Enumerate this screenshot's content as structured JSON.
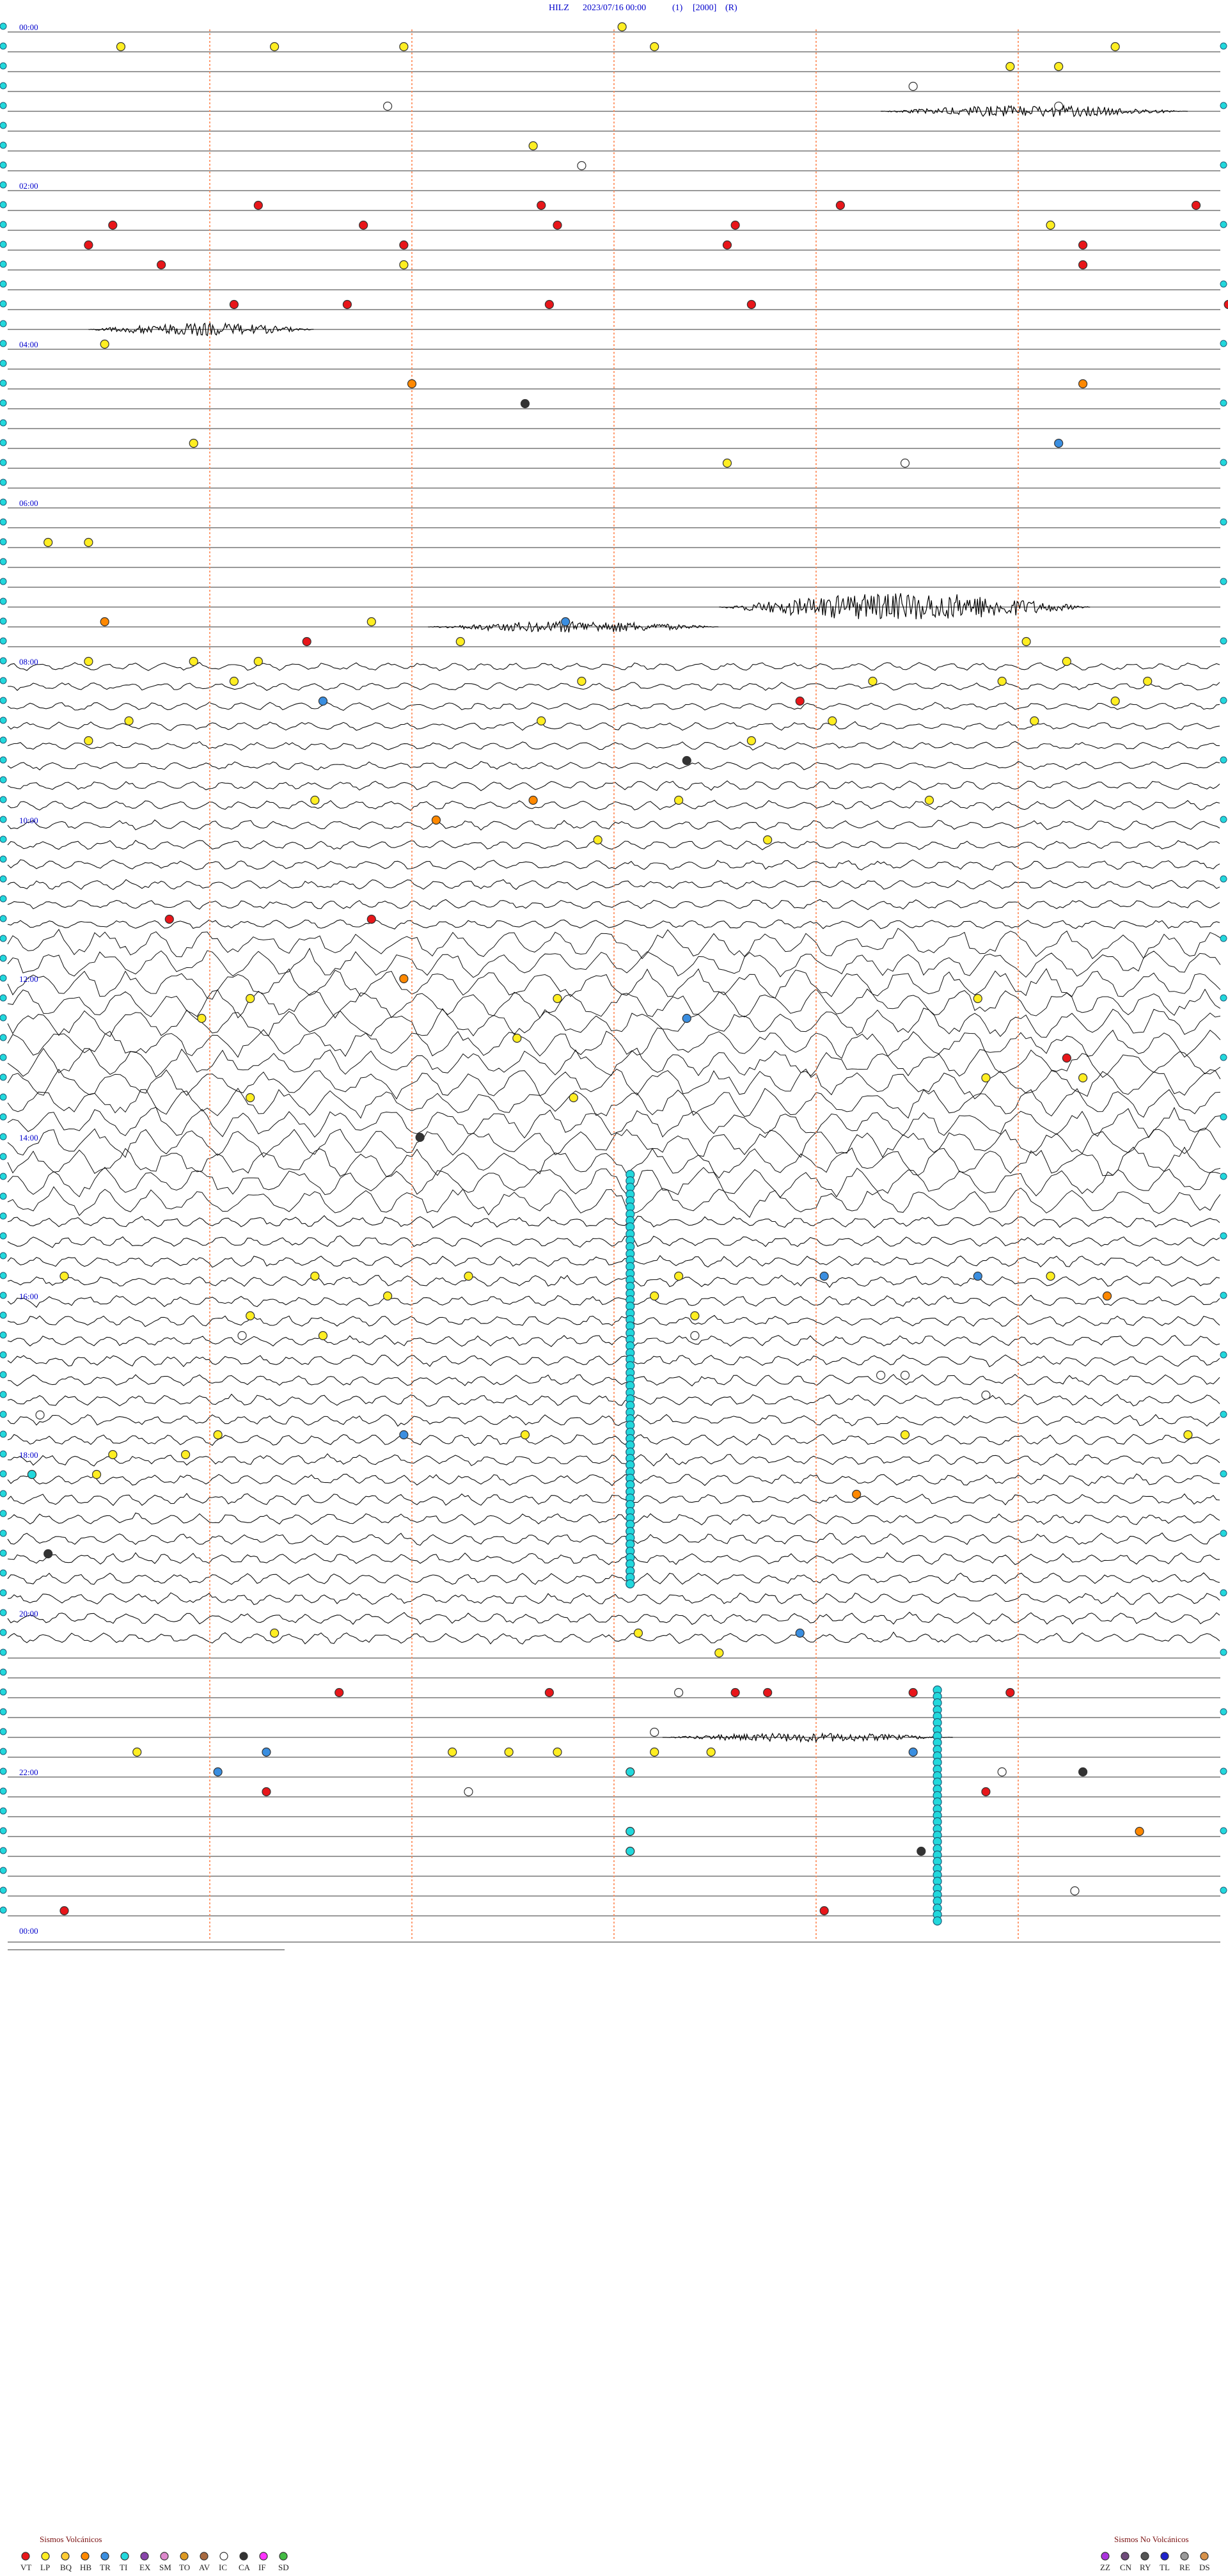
{
  "header": {
    "station": "HILZ",
    "datetime": "2023/07/16 00:00",
    "flag1": "(1)",
    "scale": "[2000]",
    "flag2": "(R)"
  },
  "chart_data": {
    "type": "seismogram",
    "rows_total": 96,
    "minutes_per_row": 15,
    "hour_labels": [
      "00:00",
      "02:00",
      "04:00",
      "06:00",
      "08:00",
      "10:00",
      "12:00",
      "14:00",
      "16:00",
      "18:00",
      "20:00",
      "22:00",
      "00:00"
    ],
    "label_every_rows": 8,
    "minute_markers": [
      2.5,
      5,
      7.5,
      10,
      12.5
    ],
    "noise_level_by_row": [
      0,
      0,
      0,
      0,
      0,
      0,
      0,
      0,
      0,
      0,
      0,
      0,
      0,
      0,
      0,
      0,
      0,
      0,
      0,
      0,
      0,
      0,
      0,
      0,
      0,
      0,
      0,
      0,
      0,
      0,
      0,
      0,
      5,
      5,
      5,
      5,
      5,
      5,
      6,
      6,
      6,
      6,
      6,
      6,
      6,
      6,
      18,
      18,
      18,
      18,
      18,
      18,
      18,
      18,
      18,
      18,
      18,
      18,
      18,
      18,
      7,
      7,
      7,
      7,
      7,
      7,
      7,
      7,
      7,
      7,
      7,
      7,
      7,
      7,
      7,
      7,
      7,
      7,
      7,
      7,
      7,
      7,
      0,
      0,
      0,
      0,
      0,
      0,
      0,
      0,
      0,
      0,
      0,
      0,
      0,
      0,
      0,
      0
    ],
    "events": [
      {
        "row": 0,
        "min": 7.6,
        "type": "LP"
      },
      {
        "row": 0,
        "min": 15.6,
        "type": "LP"
      },
      {
        "row": 0,
        "min": 16.1,
        "type": "LP"
      },
      {
        "row": 0,
        "min": 17.2,
        "type": "TR"
      },
      {
        "row": 1,
        "min": 1.4,
        "type": "LP"
      },
      {
        "row": 1,
        "min": 3.3,
        "type": "LP"
      },
      {
        "row": 1,
        "min": 4.9,
        "type": "LP"
      },
      {
        "row": 1,
        "min": 8.0,
        "type": "LP"
      },
      {
        "row": 1,
        "min": 13.7,
        "type": "LP"
      },
      {
        "row": 1,
        "min": 15.6,
        "type": "LP"
      },
      {
        "row": 1,
        "min": 16.5,
        "type": "LP"
      },
      {
        "row": 2,
        "min": 12.4,
        "type": "LP"
      },
      {
        "row": 2,
        "min": 13.0,
        "type": "LP"
      },
      {
        "row": 3,
        "min": 11.2,
        "type": "IC"
      },
      {
        "row": 4,
        "min": 4.7,
        "type": "IC"
      },
      {
        "row": 4,
        "min": 13.0,
        "type": "IC"
      },
      {
        "row": 6,
        "min": 6.5,
        "type": "LP"
      },
      {
        "row": 7,
        "min": 7.1,
        "type": "IC"
      },
      {
        "row": 9,
        "min": 3.1,
        "type": "VT"
      },
      {
        "row": 9,
        "min": 6.6,
        "type": "VT"
      },
      {
        "row": 9,
        "min": 10.3,
        "type": "VT"
      },
      {
        "row": 9,
        "min": 14.7,
        "type": "VT"
      },
      {
        "row": 10,
        "min": 1.3,
        "type": "VT"
      },
      {
        "row": 10,
        "min": 4.4,
        "type": "VT"
      },
      {
        "row": 10,
        "min": 6.8,
        "type": "VT"
      },
      {
        "row": 10,
        "min": 9.0,
        "type": "VT"
      },
      {
        "row": 10,
        "min": 12.9,
        "type": "LP"
      },
      {
        "row": 10,
        "min": 16.9,
        "type": "VT"
      },
      {
        "row": 10,
        "min": 19.0,
        "type": "VT"
      },
      {
        "row": 11,
        "min": 1.0,
        "type": "VT"
      },
      {
        "row": 11,
        "min": 4.9,
        "type": "VT"
      },
      {
        "row": 11,
        "min": 8.9,
        "type": "VT"
      },
      {
        "row": 11,
        "min": 13.3,
        "type": "VT"
      },
      {
        "row": 11,
        "min": 16.1,
        "type": "VT"
      },
      {
        "row": 11,
        "min": 16.8,
        "type": "VT"
      },
      {
        "row": 12,
        "min": 1.9,
        "type": "VT"
      },
      {
        "row": 12,
        "min": 4.9,
        "type": "LP"
      },
      {
        "row": 12,
        "min": 13.3,
        "type": "VT"
      },
      {
        "row": 12,
        "min": 16.1,
        "type": "LP"
      },
      {
        "row": 12,
        "min": 19.0,
        "type": "LP"
      },
      {
        "row": 13,
        "min": 15.8,
        "type": "IC"
      },
      {
        "row": 14,
        "min": 2.8,
        "type": "VT"
      },
      {
        "row": 14,
        "min": 4.2,
        "type": "VT"
      },
      {
        "row": 14,
        "min": 6.7,
        "type": "VT"
      },
      {
        "row": 14,
        "min": 9.2,
        "type": "VT"
      },
      {
        "row": 14,
        "min": 15.1,
        "type": "VT"
      },
      {
        "row": 14,
        "min": 18.2,
        "type": "VT"
      },
      {
        "row": 14,
        "min": 19.0,
        "type": "VT"
      },
      {
        "row": 15,
        "min": 18.2,
        "type": "LP"
      },
      {
        "row": 16,
        "min": 1.2,
        "type": "LP"
      },
      {
        "row": 18,
        "min": 5.0,
        "type": "HB"
      },
      {
        "row": 18,
        "min": 13.3,
        "type": "HB"
      },
      {
        "row": 19,
        "min": 6.4,
        "type": "CA"
      },
      {
        "row": 21,
        "min": 2.3,
        "type": "LP"
      },
      {
        "row": 21,
        "min": 13.0,
        "type": "TR"
      },
      {
        "row": 21,
        "min": 17.7,
        "type": "LP"
      },
      {
        "row": 22,
        "min": 8.9,
        "type": "LP"
      },
      {
        "row": 22,
        "min": 11.1,
        "type": "IC"
      },
      {
        "row": 26,
        "min": 0.5,
        "type": "LP"
      },
      {
        "row": 26,
        "min": 1.0,
        "type": "LP"
      },
      {
        "row": 30,
        "min": 4.5,
        "type": "LP"
      },
      {
        "row": 30,
        "min": 6.9,
        "type": "TR"
      },
      {
        "row": 30,
        "min": 1.2,
        "type": "HB"
      },
      {
        "row": 31,
        "min": 5.6,
        "type": "LP"
      },
      {
        "row": 31,
        "min": 3.7,
        "type": "VT"
      },
      {
        "row": 31,
        "min": 12.6,
        "type": "LP"
      },
      {
        "row": 32,
        "min": 1.0,
        "type": "LP"
      },
      {
        "row": 32,
        "min": 2.3,
        "type": "LP"
      },
      {
        "row": 32,
        "min": 3.1,
        "type": "LP"
      },
      {
        "row": 32,
        "min": 13.1,
        "type": "LP"
      },
      {
        "row": 33,
        "min": 15.4,
        "type": "TI"
      },
      {
        "row": 33,
        "min": 2.8,
        "type": "LP"
      },
      {
        "row": 33,
        "min": 7.1,
        "type": "LP"
      },
      {
        "row": 33,
        "min": 10.7,
        "type": "LP"
      },
      {
        "row": 33,
        "min": 12.3,
        "type": "LP"
      },
      {
        "row": 33,
        "min": 14.1,
        "type": "LP"
      },
      {
        "row": 33,
        "min": 15.6,
        "type": "VT"
      },
      {
        "row": 33,
        "min": 16.7,
        "type": "LP"
      },
      {
        "row": 33,
        "min": 17.8,
        "type": "LP"
      },
      {
        "row": 34,
        "min": 3.9,
        "type": "TR"
      },
      {
        "row": 34,
        "min": 9.8,
        "type": "VT"
      },
      {
        "row": 34,
        "min": 13.7,
        "type": "LP"
      },
      {
        "row": 34,
        "min": 18.6,
        "type": "LP"
      },
      {
        "row": 35,
        "min": 1.5,
        "type": "LP"
      },
      {
        "row": 35,
        "min": 6.6,
        "type": "LP"
      },
      {
        "row": 35,
        "min": 10.2,
        "type": "LP"
      },
      {
        "row": 35,
        "min": 12.7,
        "type": "LP"
      },
      {
        "row": 35,
        "min": 15.4,
        "type": "TI"
      },
      {
        "row": 36,
        "min": 15.6,
        "type": "VT"
      },
      {
        "row": 36,
        "min": 16.3,
        "type": "LP"
      },
      {
        "row": 36,
        "min": 9.2,
        "type": "LP"
      },
      {
        "row": 36,
        "min": 1.0,
        "type": "LP"
      },
      {
        "row": 37,
        "min": 8.4,
        "type": "CA"
      },
      {
        "row": 39,
        "min": 3.8,
        "type": "LP"
      },
      {
        "row": 39,
        "min": 6.5,
        "type": "HB"
      },
      {
        "row": 39,
        "min": 8.3,
        "type": "LP"
      },
      {
        "row": 39,
        "min": 11.4,
        "type": "LP"
      },
      {
        "row": 40,
        "min": 5.3,
        "type": "HB"
      },
      {
        "row": 40,
        "min": 17.8,
        "type": "VT"
      },
      {
        "row": 41,
        "min": 7.3,
        "type": "LP"
      },
      {
        "row": 41,
        "min": 9.4,
        "type": "LP"
      },
      {
        "row": 45,
        "min": 4.5,
        "type": "VT"
      },
      {
        "row": 45,
        "min": 2.0,
        "type": "VT"
      },
      {
        "row": 45,
        "min": 17.7,
        "type": "LP"
      },
      {
        "row": 48,
        "min": 4.9,
        "type": "HB"
      },
      {
        "row": 48,
        "min": 18.4,
        "type": "VT"
      },
      {
        "row": 49,
        "min": 3.0,
        "type": "LP"
      },
      {
        "row": 49,
        "min": 12.0,
        "type": "LP"
      },
      {
        "row": 49,
        "min": 6.8,
        "type": "LP"
      },
      {
        "row": 49,
        "min": 15.3,
        "type": "TI"
      },
      {
        "row": 50,
        "min": 2.4,
        "type": "LP"
      },
      {
        "row": 50,
        "min": 8.4,
        "type": "TR"
      },
      {
        "row": 50,
        "min": 15.8,
        "type": "TR"
      },
      {
        "row": 51,
        "min": 6.3,
        "type": "LP"
      },
      {
        "row": 52,
        "min": 13.1,
        "type": "VT"
      },
      {
        "row": 53,
        "min": 12.1,
        "type": "LP"
      },
      {
        "row": 53,
        "min": 13.3,
        "type": "LP"
      },
      {
        "row": 54,
        "min": 3.0,
        "type": "LP"
      },
      {
        "row": 54,
        "min": 7.0,
        "type": "LP"
      },
      {
        "row": 56,
        "min": 5.1,
        "type": "CA"
      },
      {
        "row": 58,
        "min": 18.8,
        "type": "VT"
      },
      {
        "row": 63,
        "min": 0.7,
        "type": "LP"
      },
      {
        "row": 63,
        "min": 3.8,
        "type": "LP"
      },
      {
        "row": 63,
        "min": 5.7,
        "type": "LP"
      },
      {
        "row": 63,
        "min": 8.3,
        "type": "LP"
      },
      {
        "row": 63,
        "min": 10.1,
        "type": "TR"
      },
      {
        "row": 63,
        "min": 12.0,
        "type": "TR"
      },
      {
        "row": 63,
        "min": 12.9,
        "type": "LP"
      },
      {
        "row": 64,
        "min": 4.7,
        "type": "LP"
      },
      {
        "row": 64,
        "min": 8.0,
        "type": "LP"
      },
      {
        "row": 64,
        "min": 13.6,
        "type": "HB"
      },
      {
        "row": 64,
        "min": 17.9,
        "type": "LP"
      },
      {
        "row": 65,
        "min": 3.0,
        "type": "LP"
      },
      {
        "row": 65,
        "min": 8.5,
        "type": "LP"
      },
      {
        "row": 66,
        "min": 2.9,
        "type": "IC"
      },
      {
        "row": 66,
        "min": 3.9,
        "type": "LP"
      },
      {
        "row": 66,
        "min": 8.5,
        "type": "IC"
      },
      {
        "row": 67,
        "min": 18.2,
        "type": "VT"
      },
      {
        "row": 68,
        "min": 10.8,
        "type": "IC"
      },
      {
        "row": 68,
        "min": 11.1,
        "type": "IC"
      },
      {
        "row": 69,
        "min": 12.1,
        "type": "IC"
      },
      {
        "row": 70,
        "min": 0.4,
        "type": "IC"
      },
      {
        "row": 71,
        "min": 2.6,
        "type": "LP"
      },
      {
        "row": 71,
        "min": 4.9,
        "type": "TR"
      },
      {
        "row": 71,
        "min": 6.4,
        "type": "LP"
      },
      {
        "row": 71,
        "min": 11.1,
        "type": "LP"
      },
      {
        "row": 71,
        "min": 14.6,
        "type": "LP"
      },
      {
        "row": 71,
        "min": 15.3,
        "type": "TI"
      },
      {
        "row": 72,
        "min": 1.3,
        "type": "LP"
      },
      {
        "row": 72,
        "min": 2.2,
        "type": "LP"
      },
      {
        "row": 73,
        "min": 1.1,
        "type": "LP"
      },
      {
        "row": 73,
        "min": 0.3,
        "type": "TI"
      },
      {
        "row": 74,
        "min": 10.5,
        "type": "HB"
      },
      {
        "row": 75,
        "min": 16.9,
        "type": "AV"
      },
      {
        "row": 76,
        "min": 15.3,
        "type": "TI"
      },
      {
        "row": 77,
        "min": 0.5,
        "type": "CA"
      },
      {
        "row": 81,
        "min": 3.3,
        "type": "LP"
      },
      {
        "row": 81,
        "min": 7.8,
        "type": "LP"
      },
      {
        "row": 81,
        "min": 9.8,
        "type": "TR"
      },
      {
        "row": 82,
        "min": 8.8,
        "type": "LP"
      },
      {
        "row": 84,
        "min": 4.1,
        "type": "VT"
      },
      {
        "row": 84,
        "min": 6.7,
        "type": "VT"
      },
      {
        "row": 84,
        "min": 8.3,
        "type": "IC"
      },
      {
        "row": 84,
        "min": 9.0,
        "type": "VT"
      },
      {
        "row": 84,
        "min": 9.4,
        "type": "VT"
      },
      {
        "row": 84,
        "min": 11.2,
        "type": "VT"
      },
      {
        "row": 84,
        "min": 12.4,
        "type": "VT"
      },
      {
        "row": 86,
        "min": 8.0,
        "type": "IC"
      },
      {
        "row": 87,
        "min": 1.6,
        "type": "LP"
      },
      {
        "row": 87,
        "min": 3.2,
        "type": "TR"
      },
      {
        "row": 87,
        "min": 5.5,
        "type": "LP"
      },
      {
        "row": 87,
        "min": 6.2,
        "type": "LP"
      },
      {
        "row": 87,
        "min": 6.8,
        "type": "LP"
      },
      {
        "row": 87,
        "min": 8.0,
        "type": "LP"
      },
      {
        "row": 87,
        "min": 8.7,
        "type": "LP"
      },
      {
        "row": 87,
        "min": 11.2,
        "type": "TR"
      },
      {
        "row": 88,
        "min": 2.6,
        "type": "TR"
      },
      {
        "row": 88,
        "min": 7.7,
        "type": "TI"
      },
      {
        "row": 88,
        "min": 12.3,
        "type": "IC"
      },
      {
        "row": 88,
        "min": 13.3,
        "type": "CA"
      },
      {
        "row": 89,
        "min": 3.2,
        "type": "VT"
      },
      {
        "row": 89,
        "min": 5.7,
        "type": "IC"
      },
      {
        "row": 89,
        "min": 12.1,
        "type": "VT"
      },
      {
        "row": 89,
        "min": 16.0,
        "type": "CA"
      },
      {
        "row": 91,
        "min": 14.0,
        "type": "HB"
      },
      {
        "row": 91,
        "min": 7.7,
        "type": "TI"
      },
      {
        "row": 92,
        "min": 7.7,
        "type": "TI"
      },
      {
        "row": 92,
        "min": 11.3,
        "type": "CA"
      },
      {
        "row": 94,
        "min": 18.6,
        "type": "IC"
      },
      {
        "row": 94,
        "min": 13.2,
        "type": "IC"
      },
      {
        "row": 95,
        "min": 10.1,
        "type": "VT"
      },
      {
        "row": 95,
        "min": 0.7,
        "type": "VT"
      }
    ],
    "ti_columns": [
      {
        "min": 7.7,
        "row_from": 71,
        "row_to": 78
      },
      {
        "min": 11.5,
        "row_from": 84,
        "row_to": 95
      },
      {
        "min": 7.7,
        "row_from": 58,
        "row_to": 78
      }
    ],
    "bursts": [
      {
        "row": 4,
        "min_from": 10.8,
        "min_to": 14.6,
        "amp": 9
      },
      {
        "row": 15,
        "min_from": 1.0,
        "min_to": 3.8,
        "amp": 10
      },
      {
        "row": 29,
        "min_from": 8.8,
        "min_to": 13.4,
        "amp": 22
      },
      {
        "row": 30,
        "min_from": 5.2,
        "min_to": 8.8,
        "amp": 9
      },
      {
        "row": 86,
        "min_from": 8.1,
        "min_to": 11.7,
        "amp": 7
      }
    ]
  },
  "legend": {
    "volcanic_title": "Sismos Volcánicos",
    "volcanic": [
      {
        "code": "VT",
        "color": "#e8161a"
      },
      {
        "code": "LP",
        "color": "#ffee22"
      },
      {
        "code": "BQ",
        "color": "#ffcc33"
      },
      {
        "code": "HB",
        "color": "#ff8800"
      },
      {
        "code": "TR",
        "color": "#3a8ee0"
      },
      {
        "code": "TI",
        "color": "#22d8dc"
      },
      {
        "code": "EX",
        "color": "#8844aa"
      },
      {
        "code": "SM",
        "color": "#dd88cc"
      },
      {
        "code": "TO",
        "color": "#dd9922"
      },
      {
        "code": "AV",
        "color": "#a86a40"
      },
      {
        "code": "IC",
        "color": "#ffffff"
      },
      {
        "code": "CA",
        "color": "#333333"
      },
      {
        "code": "IF",
        "color": "#ff33ff"
      },
      {
        "code": "SD",
        "color": "#44bb44"
      }
    ],
    "nonvolcanic_title": "Sismos No Volcánicos",
    "nonvolcanic": [
      {
        "code": "ZZ",
        "color": "#aa33dd"
      },
      {
        "code": "CN",
        "color": "#6e4a7a"
      },
      {
        "code": "RY",
        "color": "#555555"
      },
      {
        "code": "TL",
        "color": "#1e22cc"
      },
      {
        "code": "RE",
        "color": "#999999"
      },
      {
        "code": "DS",
        "color": "#d8924a"
      }
    ]
  }
}
